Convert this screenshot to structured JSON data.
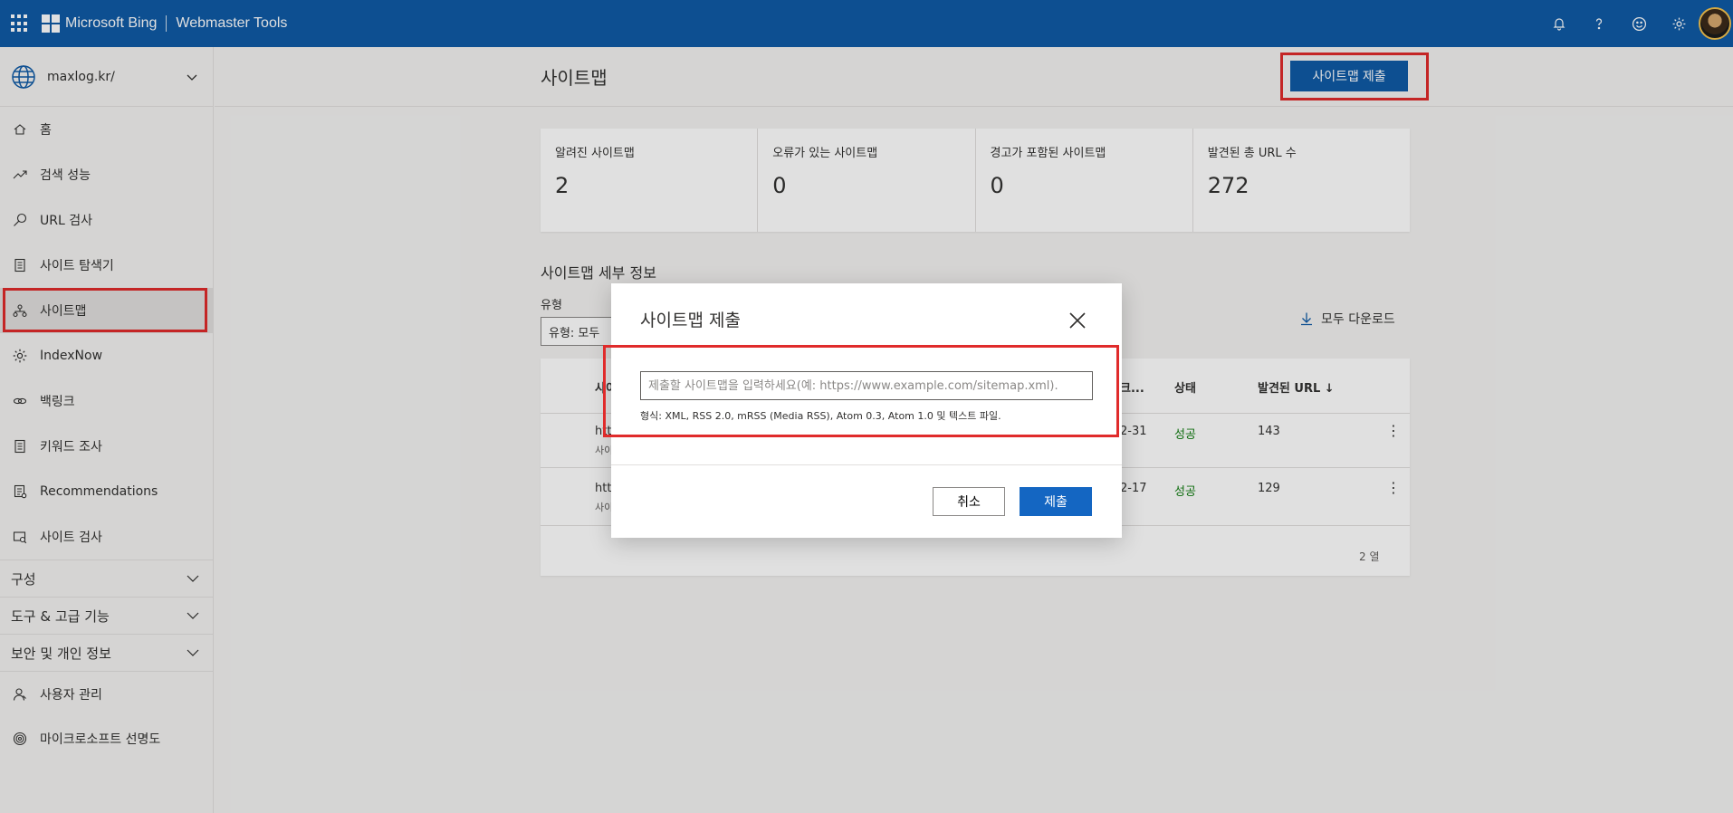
{
  "topbar": {
    "brand": "Microsoft Bing",
    "product": "Webmaster Tools"
  },
  "sidebar": {
    "site": "maxlog.kr/",
    "items": [
      {
        "label": "홈",
        "icon": "home-icon"
      },
      {
        "label": "검색 성능",
        "icon": "trend-icon"
      },
      {
        "label": "URL 검사",
        "icon": "search-icon"
      },
      {
        "label": "사이트 탐색기",
        "icon": "document-icon"
      },
      {
        "label": "사이트맵",
        "icon": "sitemap-icon"
      },
      {
        "label": "IndexNow",
        "icon": "gear-icon"
      },
      {
        "label": "백링크",
        "icon": "link-icon"
      },
      {
        "label": "키워드 조사",
        "icon": "document-icon"
      },
      {
        "label": "Recommendations",
        "icon": "checklist-icon"
      },
      {
        "label": "사이트 검사",
        "icon": "scan-icon"
      }
    ],
    "sections": [
      "구성",
      "도구 & 고급 기능",
      "보안 및 개인 정보"
    ],
    "bottom_items": [
      {
        "label": "사용자 관리",
        "icon": "user-icon"
      },
      {
        "label": "마이크로소프트 선명도",
        "icon": "clarity-icon"
      }
    ]
  },
  "main": {
    "title": "사이트맵",
    "submit_label": "사이트맵 제출",
    "cards": [
      {
        "label": "알려진 사이트맵",
        "value": "2"
      },
      {
        "label": "오류가 있는 사이트맵",
        "value": "0"
      },
      {
        "label": "경고가 포함된 사이트맵",
        "value": "0"
      },
      {
        "label": "발견된 총 URL 수",
        "value": "272"
      }
    ],
    "details_title": "사이트맵 세부 정보",
    "type_label": "유형",
    "type_value": "유형: 모두",
    "download_all": "모두 다운로드",
    "table": {
      "col_sitemap": "사이",
      "col_crawl": "크...",
      "col_status": "상태",
      "col_urls": "발견된 URL ↓",
      "rows": [
        {
          "url": "htt",
          "sub": "사이",
          "date": "2-31",
          "status": "성공",
          "urls": "143"
        },
        {
          "url": "htt",
          "sub": "사이",
          "date": "2-17",
          "status": "성공",
          "urls": "129"
        }
      ],
      "footer": "2 열"
    }
  },
  "dialog": {
    "title": "사이트맵 제출",
    "input_placeholder": "제출할 사이트맵을 입력하세요(예: https://www.example.com/sitemap.xml).",
    "hint": "형식: XML, RSS 2.0, mRSS (Media RSS), Atom 0.3, Atom 1.0 및 텍스트 파일.",
    "cancel": "취소",
    "submit": "제출"
  },
  "colors": {
    "topbar": "#0f5aa6",
    "primary": "#1466c2",
    "highlight": "#e02b2b",
    "success": "#107c10"
  }
}
